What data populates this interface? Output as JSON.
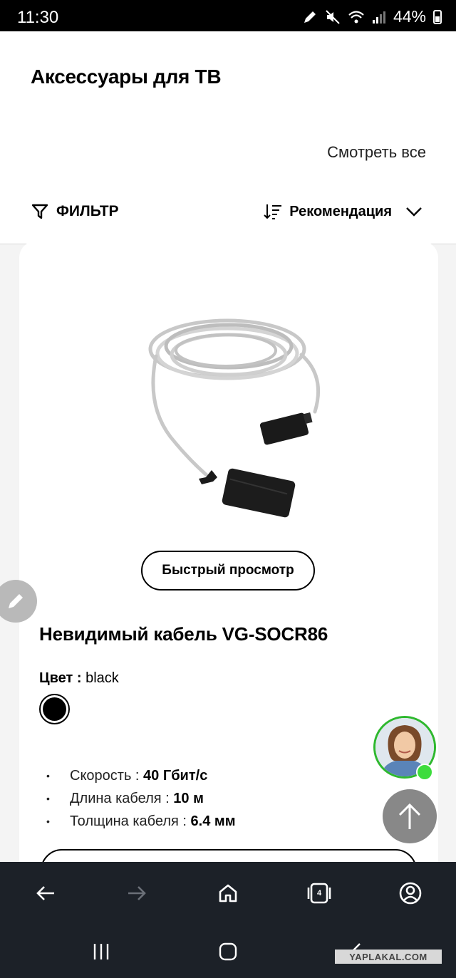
{
  "status_bar": {
    "time": "11:30",
    "battery": "44%"
  },
  "header": {
    "title": "Аксессуары для ТВ",
    "view_all": "Смотреть все",
    "filter_label": "ФИЛЬТР",
    "sort_label": "Рекомендация"
  },
  "product": {
    "quick_view_label": "Быстрый просмотр",
    "name": "Невидимый кабель VG-SOCR86",
    "color_label": "Цвет :",
    "color_value": "black",
    "swatch_color": "#000000",
    "specs": [
      {
        "label": "Скорость :",
        "value": "40 Гбит/с"
      },
      {
        "label": "Длина кабеля :",
        "value": "10 м"
      },
      {
        "label": "Толщина кабеля :",
        "value": "6.4 мм"
      }
    ]
  },
  "browser_nav": {
    "tabs_count": "4"
  },
  "watermark": "YAPLAKAL.COM",
  "icons": [
    "edit-icon",
    "back-icon",
    "forward-icon",
    "home-icon",
    "tabs-icon",
    "account-icon",
    "filter-icon",
    "sort-icon",
    "chevron-down-icon",
    "arrow-up-icon"
  ],
  "colors": {
    "nav_bg": "#1c2128",
    "online": "#3ddc3d",
    "fab": "#888888"
  }
}
